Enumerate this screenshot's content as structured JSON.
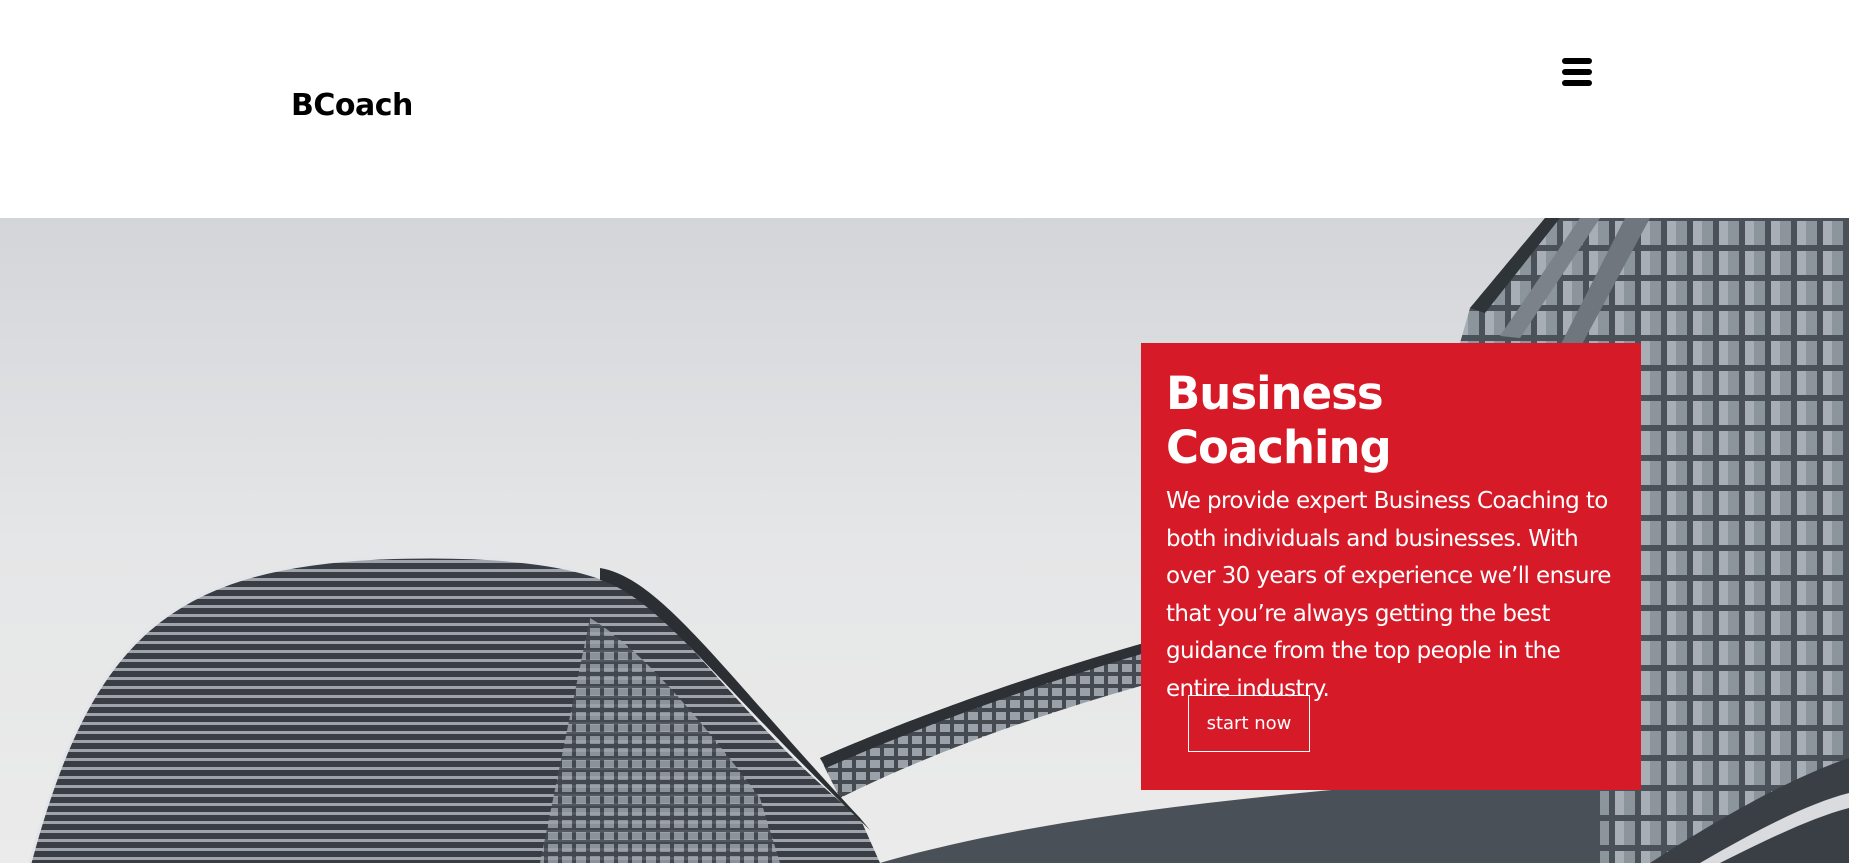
{
  "header": {
    "brand": "BCoach",
    "menu_icon": "hamburger-menu-icon"
  },
  "hero": {
    "background": "grayscale-modern-architecture-photo",
    "card": {
      "title": "Business Coaching",
      "text": "We provide expert Business Coaching to both individuals and businesses. With over 30 years of experience we’ll ensure that you’re always getting the best guidance from the top people in the entire industry.",
      "button_label": "start now",
      "color": "#d71a28"
    }
  }
}
